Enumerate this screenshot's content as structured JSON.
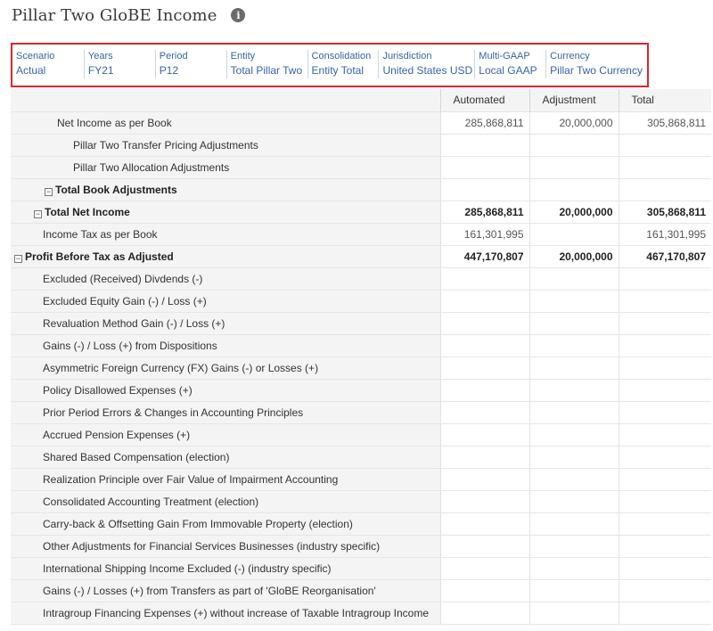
{
  "page": {
    "title": "Pillar Two GloBE Income",
    "info_icon": "info-icon"
  },
  "pov": [
    {
      "label": "Scenario",
      "value": "Actual"
    },
    {
      "label": "Years",
      "value": "FY21"
    },
    {
      "label": "Period",
      "value": "P12"
    },
    {
      "label": "Entity",
      "value": "Total Pillar Two"
    },
    {
      "label": "Consolidation",
      "value": "Entity Total"
    },
    {
      "label": "Jurisdiction",
      "value": "United States USD"
    },
    {
      "label": "Multi-GAAP",
      "value": "Local GAAP"
    },
    {
      "label": "Currency",
      "value": "Pillar Two Currency"
    }
  ],
  "grid": {
    "columns": [
      "Automated",
      "Adjustment",
      "Total"
    ],
    "collapse_glyph": "−",
    "rows": [
      {
        "label": "Net Income as per Book",
        "level": 3,
        "bold": false,
        "toggle": false,
        "values": [
          "285,868,811",
          "20,000,000",
          "305,868,811"
        ]
      },
      {
        "label": "Pillar Two Transfer Pricing Adjustments",
        "level": 4,
        "bold": false,
        "toggle": false,
        "values": [
          "",
          "",
          ""
        ]
      },
      {
        "label": "Pillar Two Allocation Adjustments",
        "level": 4,
        "bold": false,
        "toggle": false,
        "values": [
          "",
          "",
          ""
        ]
      },
      {
        "label": "Total Book Adjustments",
        "level": 3,
        "bold": true,
        "toggle": true,
        "values": [
          "",
          "",
          ""
        ]
      },
      {
        "label": "Total Net Income",
        "level": 2,
        "bold": true,
        "toggle": true,
        "values": [
          "285,868,811",
          "20,000,000",
          "305,868,811"
        ]
      },
      {
        "label": "Income Tax as per Book",
        "level": 1,
        "bold": false,
        "toggle": false,
        "values": [
          "161,301,995",
          "",
          "161,301,995"
        ]
      },
      {
        "label": "Profit Before Tax as Adjusted",
        "level": 0,
        "bold": true,
        "toggle": true,
        "values": [
          "447,170,807",
          "20,000,000",
          "467,170,807"
        ]
      },
      {
        "label": "Excluded (Received) Divdends (-)",
        "level": 1,
        "bold": false,
        "toggle": false,
        "values": [
          "",
          "",
          ""
        ]
      },
      {
        "label": "Excluded Equity Gain (-) / Loss (+)",
        "level": 1,
        "bold": false,
        "toggle": false,
        "values": [
          "",
          "",
          ""
        ]
      },
      {
        "label": "Revaluation Method Gain (-) / Loss (+)",
        "level": 1,
        "bold": false,
        "toggle": false,
        "values": [
          "",
          "",
          ""
        ]
      },
      {
        "label": "Gains (-) / Loss (+) from Dispositions",
        "level": 1,
        "bold": false,
        "toggle": false,
        "values": [
          "",
          "",
          ""
        ]
      },
      {
        "label": "Asymmetric Foreign Currency (FX) Gains (-) or Losses (+)",
        "level": 1,
        "bold": false,
        "toggle": false,
        "values": [
          "",
          "",
          ""
        ]
      },
      {
        "label": "Policy Disallowed Expenses (+)",
        "level": 1,
        "bold": false,
        "toggle": false,
        "values": [
          "",
          "",
          ""
        ]
      },
      {
        "label": "Prior Period Errors & Changes in Accounting Principles",
        "level": 1,
        "bold": false,
        "toggle": false,
        "values": [
          "",
          "",
          ""
        ]
      },
      {
        "label": "Accrued Pension Expenses (+)",
        "level": 1,
        "bold": false,
        "toggle": false,
        "values": [
          "",
          "",
          ""
        ]
      },
      {
        "label": "Shared Based Compensation (election)",
        "level": 1,
        "bold": false,
        "toggle": false,
        "values": [
          "",
          "",
          ""
        ]
      },
      {
        "label": "Realization Principle over Fair Value of Impairment Accounting",
        "level": 1,
        "bold": false,
        "toggle": false,
        "values": [
          "",
          "",
          ""
        ]
      },
      {
        "label": "Consolidated Accounting Treatment (election)",
        "level": 1,
        "bold": false,
        "toggle": false,
        "values": [
          "",
          "",
          ""
        ]
      },
      {
        "label": "Carry-back & Offsetting Gain From Immovable Property (election)",
        "level": 1,
        "bold": false,
        "toggle": false,
        "values": [
          "",
          "",
          ""
        ]
      },
      {
        "label": "Other Adjustments for Financial Services Businesses (industry specific)",
        "level": 1,
        "bold": false,
        "toggle": false,
        "values": [
          "",
          "",
          ""
        ]
      },
      {
        "label": "International Shipping Income Excluded (-) (industry specific)",
        "level": 1,
        "bold": false,
        "toggle": false,
        "values": [
          "",
          "",
          ""
        ]
      },
      {
        "label": "Gains (-) / Losses (+) from Transfers as part of 'GloBE Reorganisation'",
        "level": 1,
        "bold": false,
        "toggle": false,
        "values": [
          "",
          "",
          ""
        ]
      },
      {
        "label": "Intragroup Financing Expenses (+) without increase of Taxable Intragroup Income",
        "level": 1,
        "bold": false,
        "toggle": false,
        "values": [
          "",
          "",
          ""
        ]
      }
    ]
  },
  "colors": {
    "pov_border": "#d9262f",
    "pov_text": "#3a63a8",
    "label_bg": "#f4f4f4"
  }
}
